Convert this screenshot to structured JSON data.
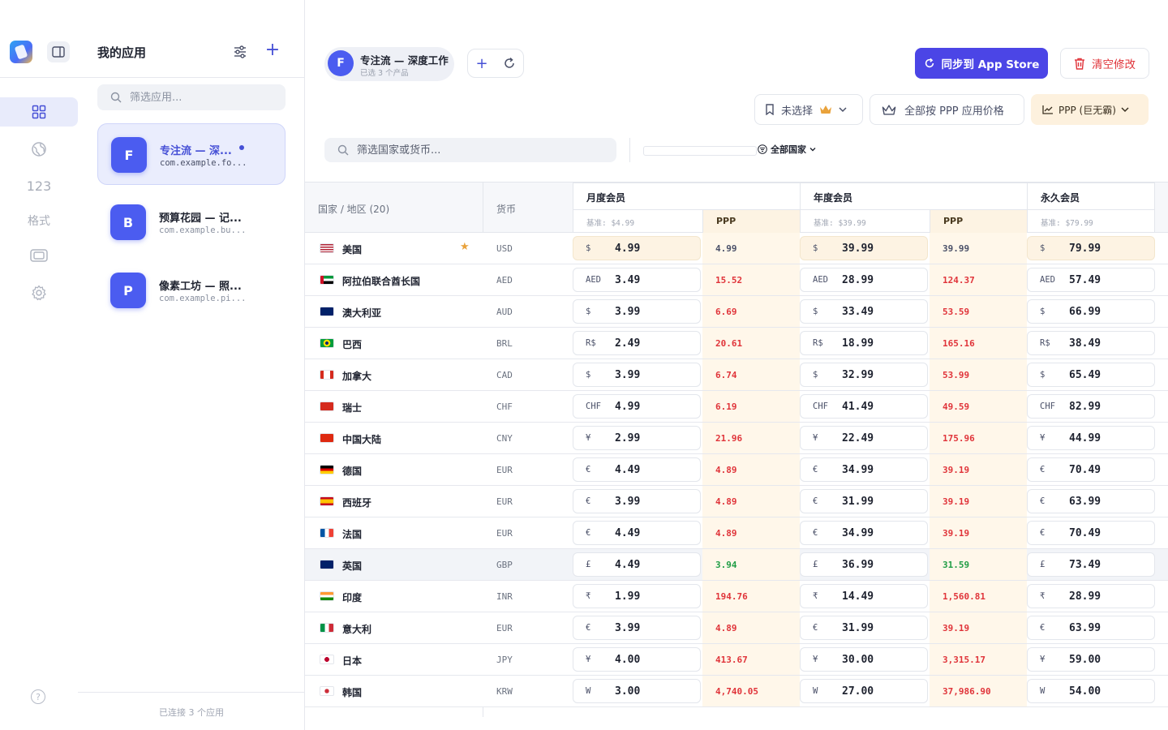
{
  "rail": {
    "items": [
      {
        "name": "grid",
        "icon": "grid-icon"
      },
      {
        "name": "globe",
        "icon": "globe-icon"
      },
      {
        "name": "numbers",
        "label": "123"
      },
      {
        "name": "format",
        "label": "格式"
      },
      {
        "name": "media",
        "icon": "film-icon"
      },
      {
        "name": "settings",
        "icon": "gear-icon"
      }
    ]
  },
  "sidebar": {
    "title": "我的应用",
    "search_placeholder": "筛选应用...",
    "apps": [
      {
        "initial": "F",
        "name": "专注流 — 深...",
        "bundle": "com.example.fo...",
        "selected": true
      },
      {
        "initial": "B",
        "name": "预算花园 — 记...",
        "bundle": "com.example.bu...",
        "selected": false
      },
      {
        "initial": "P",
        "name": "像素工坊 — 照...",
        "bundle": "com.example.pi...",
        "selected": false
      }
    ],
    "footer": "已连接 3 个应用"
  },
  "header": {
    "chip": {
      "initial": "F",
      "name": "专注流 — 深度工作",
      "sub": "已选 3 个产品"
    },
    "sync_label": "同步到 App Store",
    "clear_label": "清空修改",
    "select_label": "未选择",
    "apply_ppp_label": "全部按 PPP 应用价格",
    "ppp_mode_label": "PPP (巨无霸)",
    "country_search_placeholder": "筛选国家或货币...",
    "region_filter": "全部国家"
  },
  "colors": {
    "accent": "#4b45e6",
    "danger": "#e0343a",
    "ppp_bg": "#fdf3e3",
    "price_up": "#e0343a",
    "price_down": "#1f9d45"
  },
  "table": {
    "col_country": "国家 / 地区 (20)",
    "col_currency": "货币",
    "tiers": [
      {
        "name": "月度会员",
        "base": "基准: $4.99",
        "ppp": "PPP"
      },
      {
        "name": "年度会员",
        "base": "基准: $39.99",
        "ppp": "PPP"
      },
      {
        "name": "永久会员",
        "base": "基准: $79.99",
        "ppp": ""
      }
    ],
    "rows": [
      {
        "flag": "us",
        "country": "美国",
        "currency": "USD",
        "star": true,
        "sym": "$",
        "m": "4.99",
        "mp": "4.99",
        "y": "39.99",
        "yp": "39.99",
        "l": "79.99",
        "trend": "neutral"
      },
      {
        "flag": "ae",
        "country": "阿拉伯联合酋长国",
        "currency": "AED",
        "sym": "AED",
        "m": "3.49",
        "mp": "15.52",
        "y": "28.99",
        "yp": "124.37",
        "l": "57.49",
        "trend": "up"
      },
      {
        "flag": "au",
        "country": "澳大利亚",
        "currency": "AUD",
        "sym": "$",
        "m": "3.99",
        "mp": "6.69",
        "y": "33.49",
        "yp": "53.59",
        "l": "66.99",
        "trend": "up"
      },
      {
        "flag": "br",
        "country": "巴西",
        "currency": "BRL",
        "sym": "R$",
        "m": "2.49",
        "mp": "20.61",
        "y": "18.99",
        "yp": "165.16",
        "l": "38.49",
        "trend": "up"
      },
      {
        "flag": "ca",
        "country": "加拿大",
        "currency": "CAD",
        "sym": "$",
        "m": "3.99",
        "mp": "6.74",
        "y": "32.99",
        "yp": "53.99",
        "l": "65.49",
        "trend": "up"
      },
      {
        "flag": "ch",
        "country": "瑞士",
        "currency": "CHF",
        "sym": "CHF",
        "m": "4.99",
        "mp": "6.19",
        "y": "41.49",
        "yp": "49.59",
        "l": "82.99",
        "trend": "up"
      },
      {
        "flag": "cn",
        "country": "中国大陆",
        "currency": "CNY",
        "sym": "¥",
        "m": "2.99",
        "mp": "21.96",
        "y": "22.49",
        "yp": "175.96",
        "l": "44.99",
        "trend": "up"
      },
      {
        "flag": "de",
        "country": "德国",
        "currency": "EUR",
        "sym": "€",
        "m": "4.49",
        "mp": "4.89",
        "y": "34.99",
        "yp": "39.19",
        "l": "70.49",
        "trend": "up"
      },
      {
        "flag": "es",
        "country": "西班牙",
        "currency": "EUR",
        "sym": "€",
        "m": "3.99",
        "mp": "4.89",
        "y": "31.99",
        "yp": "39.19",
        "l": "63.99",
        "trend": "up"
      },
      {
        "flag": "fr",
        "country": "法国",
        "currency": "EUR",
        "sym": "€",
        "m": "4.49",
        "mp": "4.89",
        "y": "34.99",
        "yp": "39.19",
        "l": "70.49",
        "trend": "up"
      },
      {
        "flag": "gb",
        "country": "英国",
        "currency": "GBP",
        "sym": "£",
        "m": "4.49",
        "mp": "3.94",
        "y": "36.99",
        "yp": "31.59",
        "l": "73.49",
        "trend": "down",
        "highlight": true
      },
      {
        "flag": "in",
        "country": "印度",
        "currency": "INR",
        "sym": "₹",
        "m": "1.99",
        "mp": "194.76",
        "y": "14.49",
        "yp": "1,560.81",
        "l": "28.99",
        "trend": "up"
      },
      {
        "flag": "it",
        "country": "意大利",
        "currency": "EUR",
        "sym": "€",
        "m": "3.99",
        "mp": "4.89",
        "y": "31.99",
        "yp": "39.19",
        "l": "63.99",
        "trend": "up"
      },
      {
        "flag": "jp",
        "country": "日本",
        "currency": "JPY",
        "sym": "¥",
        "m": "4.00",
        "mp": "413.67",
        "y": "30.00",
        "yp": "3,315.17",
        "l": "59.00",
        "trend": "up"
      },
      {
        "flag": "kr",
        "country": "韩国",
        "currency": "KRW",
        "sym": "W",
        "m": "3.00",
        "mp": "4,740.05",
        "y": "27.00",
        "yp": "37,986.90",
        "l": "54.00",
        "trend": "up"
      }
    ]
  }
}
